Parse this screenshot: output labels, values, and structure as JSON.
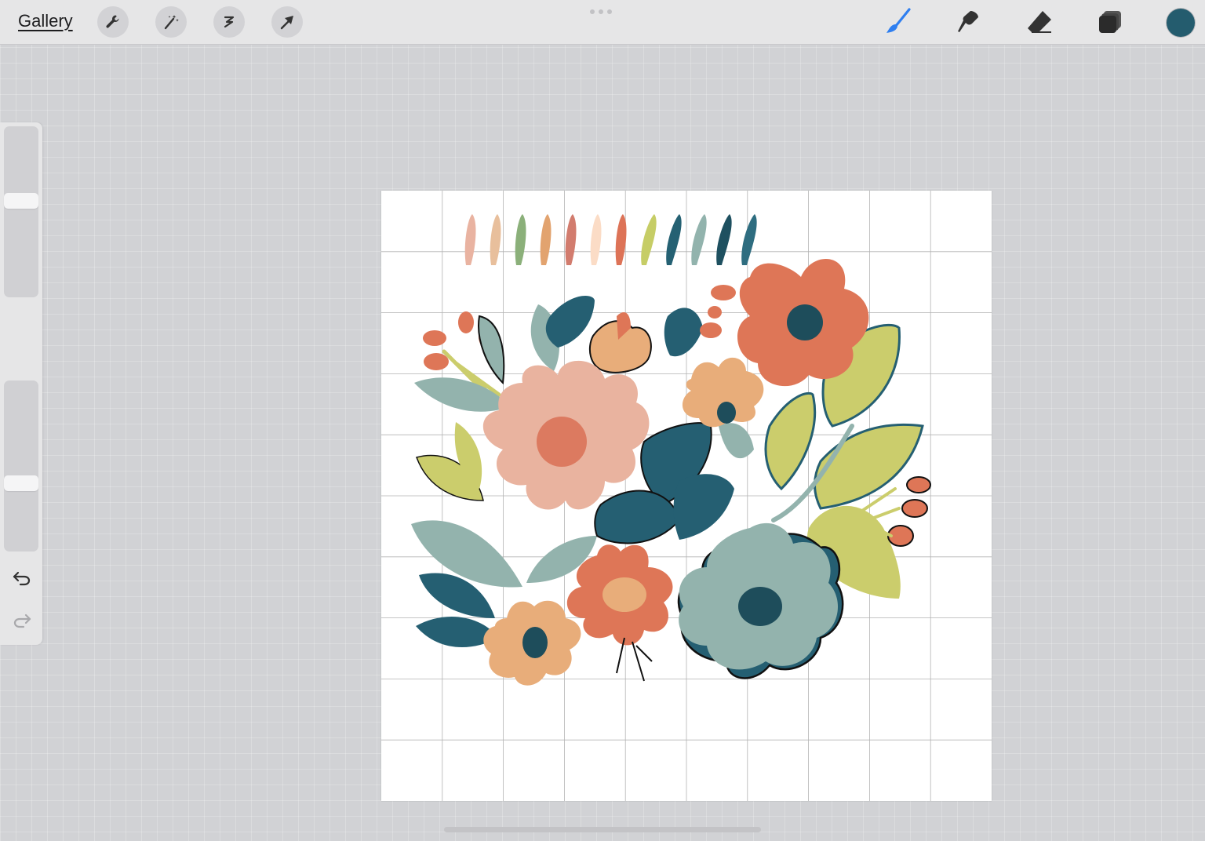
{
  "toolbar": {
    "gallery_label": "Gallery",
    "left_tools": [
      "wrench-icon",
      "magic-wand-icon",
      "selection-icon",
      "transform-arrow-icon"
    ],
    "right_tools": [
      "brush-icon",
      "smudge-icon",
      "eraser-icon",
      "layers-icon"
    ],
    "active_tool": "brush-icon",
    "active_color": "#245c6e"
  },
  "sidebar": {
    "brush_size_level": 0.43,
    "opacity_level": 0.61,
    "controls": [
      "modify-button",
      "undo-icon",
      "redo-icon"
    ]
  },
  "canvas": {
    "background": "#ffffff",
    "grid_divisions": 10,
    "palette_swatches": [
      "#e9b3a1",
      "#e8bf9c",
      "#8bb07a",
      "#e2a36f",
      "#d27c6e",
      "#fbdcc6",
      "#dd7357",
      "#c6cd66",
      "#256173",
      "#92b3ad",
      "#1e5060",
      "#2e6d80"
    ]
  },
  "colors": {
    "coral": "#de7657",
    "peach": "#e9b39f",
    "sand": "#e8ad7a",
    "teal": "#255f72",
    "sage": "#93b3ad",
    "olive": "#cbcd6c"
  }
}
